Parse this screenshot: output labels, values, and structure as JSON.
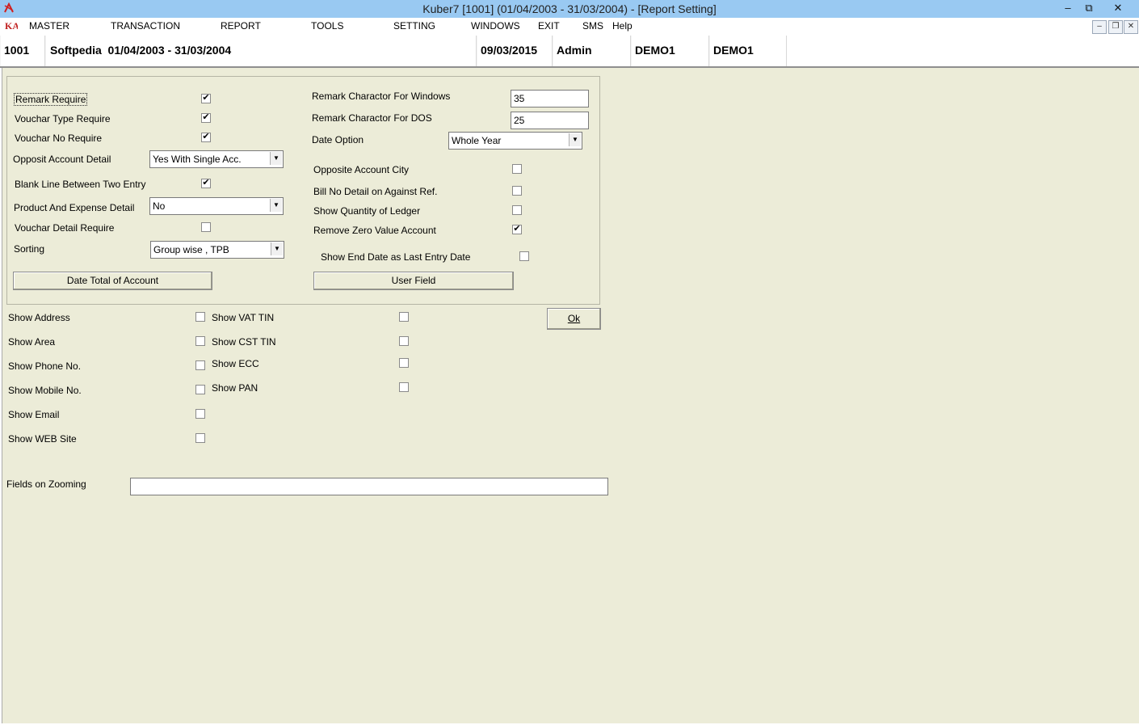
{
  "window": {
    "title": "Kuber7 [1001] (01/04/2003 - 31/03/2004) - [Report Setting]",
    "minimize": "–",
    "restore": "⧉",
    "close": "✕"
  },
  "menu": {
    "master": "MASTER",
    "transaction": "TRANSACTION",
    "report": "REPORT",
    "tools": "TOOLS",
    "setting": "SETTING",
    "windows": "WINDOWS",
    "exit": "EXIT",
    "sms": "SMS",
    "help": "Help"
  },
  "mdi": {
    "minimize": "–",
    "restore": "❐",
    "close": "✕"
  },
  "info": {
    "company_code": "1001",
    "company": "Softpedia  01/04/2003 - 31/03/2004",
    "date": "09/03/2015",
    "user": "Admin",
    "db1": "DEMO1",
    "db2": "DEMO1"
  },
  "left": {
    "remark_require": {
      "label": "Remark Require",
      "checked": true
    },
    "vouchar_type_require": {
      "label": "Vouchar Type Require",
      "checked": true
    },
    "vouchar_no_require": {
      "label": "Vouchar No Require",
      "checked": true
    },
    "opposit_account_detail": {
      "label": "Opposit Account Detail",
      "value": "Yes With Single Acc."
    },
    "blank_line": {
      "label": "Blank Line Between Two Entry",
      "checked": true
    },
    "product_expense": {
      "label": "Product And Expense Detail",
      "value": "No"
    },
    "vouchar_detail_require": {
      "label": "Vouchar Detail Require",
      "checked": false
    },
    "sorting": {
      "label": "Sorting",
      "value": "Group wise , TPB"
    },
    "date_total_button": "Date Total of Account"
  },
  "right": {
    "remark_windows": {
      "label": "Remark Charactor For Windows",
      "value": "35"
    },
    "remark_dos": {
      "label": "Remark Charactor For DOS",
      "value": "25"
    },
    "date_option": {
      "label": "Date Option",
      "value": "Whole Year"
    },
    "opposite_city": {
      "label": "Opposite Account City",
      "checked": false
    },
    "bill_no_detail": {
      "label": "Bill No Detail on Against Ref.",
      "checked": false
    },
    "show_quantity": {
      "label": "Show Quantity of Ledger",
      "checked": false
    },
    "remove_zero": {
      "label": "Remove Zero Value Account",
      "checked": true
    },
    "show_end_date": {
      "label": "Show End Date as Last Entry Date",
      "checked": false
    },
    "user_field_button": "User Field"
  },
  "show_left": [
    {
      "label": "Show Address",
      "checked": false
    },
    {
      "label": "Show Area",
      "checked": false
    },
    {
      "label": "Show Phone No.",
      "checked": false
    },
    {
      "label": "Show Mobile No.",
      "checked": false
    },
    {
      "label": "Show Email",
      "checked": false
    },
    {
      "label": "Show WEB Site",
      "checked": false
    }
  ],
  "show_right": [
    {
      "label": "Show VAT TIN",
      "checked": false
    },
    {
      "label": "Show CST TIN",
      "checked": false
    },
    {
      "label": "Show ECC",
      "checked": false
    },
    {
      "label": "Show PAN",
      "checked": false
    }
  ],
  "ok_button": "Ok",
  "zooming": {
    "label": "Fields on Zooming",
    "value": ""
  },
  "check_mark": "✔",
  "dropdown_arrow": "▼"
}
